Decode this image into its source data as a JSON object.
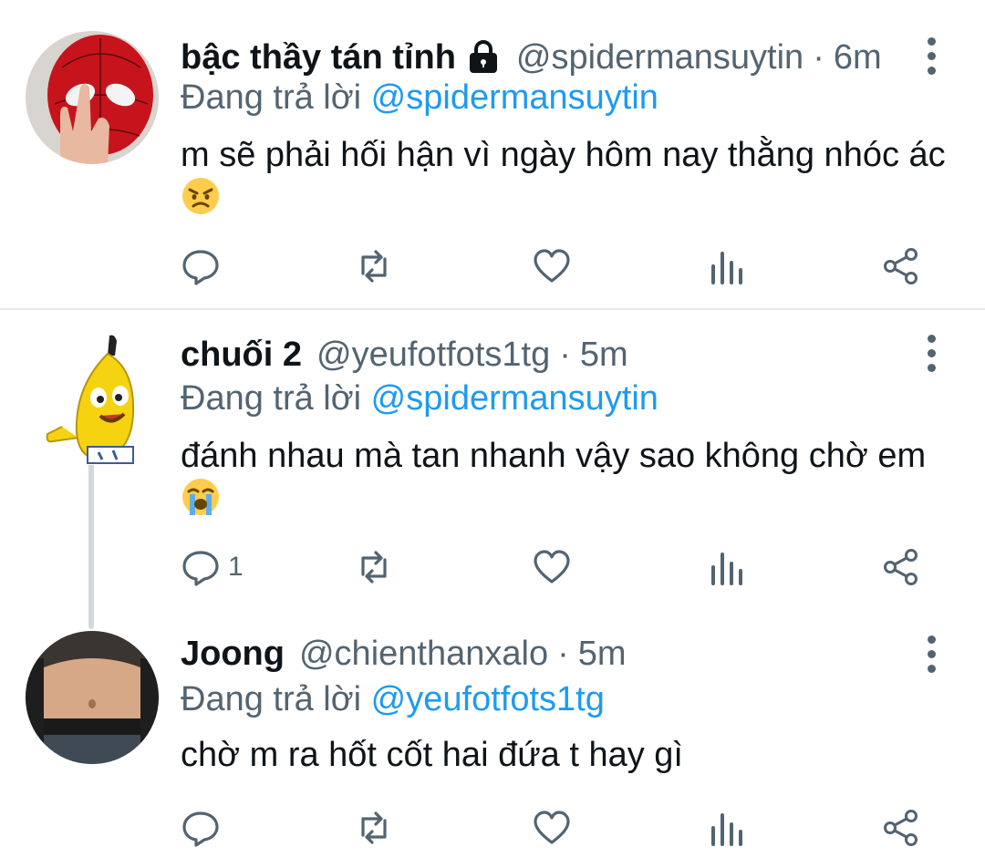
{
  "colors": {
    "accent": "#1d9bf0",
    "muted": "#536471",
    "text": "#0f1419"
  },
  "tweets": [
    {
      "name": "bậc thầy tán tỉnh",
      "protected": true,
      "handle": "@spidermansuytin",
      "separator": "·",
      "time": "6m",
      "reply_prefix": "Đang trả lời",
      "reply_to": "@spidermansuytin",
      "text": "m sẽ phải hối hận vì ngày hôm nay thằng nhóc ác",
      "emoji": "angry-face",
      "reply_count": ""
    },
    {
      "name": "chuối 2",
      "protected": false,
      "handle": "@yeufotfots1tg",
      "separator": "·",
      "time": "5m",
      "reply_prefix": "Đang trả lời",
      "reply_to": "@spidermansuytin",
      "text": "đánh nhau mà tan nhanh vậy sao không chờ em",
      "emoji": "loudly-crying-face",
      "reply_count": "1"
    },
    {
      "name": "Joong",
      "protected": false,
      "handle": "@chienthanxalo",
      "separator": "·",
      "time": "5m",
      "reply_prefix": "Đang trả lời",
      "reply_to": "@yeufotfots1tg",
      "text": "chờ m ra hốt cốt hai đứa t hay gì",
      "emoji": "",
      "reply_count": ""
    }
  ]
}
